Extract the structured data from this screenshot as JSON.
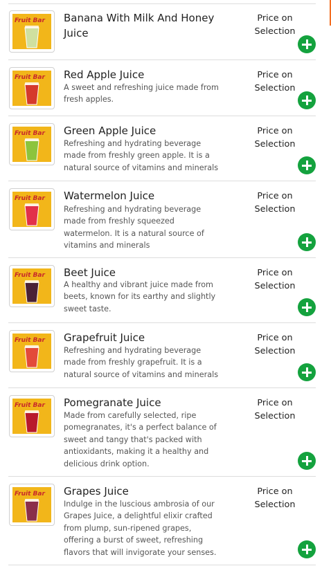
{
  "price_label": "Price on Selection",
  "accent_color": "#14a23e",
  "items": [
    {
      "name": "Banana With Milk And Honey Juice",
      "description": "",
      "icon": "banana-juice-cup",
      "juice_color": "#cfe0a0"
    },
    {
      "name": "Red Apple Juice",
      "description": "A sweet and refreshing juice made from fresh apples.",
      "icon": "red-apple-juice-cup",
      "juice_color": "#d53a2c"
    },
    {
      "name": "Green Apple Juice",
      "description": "Refreshing and hydrating beverage made from freshly green apple. It is a natural source of vitamins and minerals",
      "icon": "green-apple-juice-cup",
      "juice_color": "#8cc43d"
    },
    {
      "name": "Watermelon Juice",
      "description": "Refreshing and hydrating beverage made from freshly squeezed watermelon. It is a natural source of vitamins and minerals",
      "icon": "watermelon-juice-cup",
      "juice_color": "#e2304a"
    },
    {
      "name": "Beet Juice",
      "description": "A healthy and vibrant juice made from beets, known for its earthy and slightly sweet taste.",
      "icon": "beet-juice-cup",
      "juice_color": "#4a2236"
    },
    {
      "name": "Grapefruit Juice",
      "description": "Refreshing and hydrating beverage made from freshly grapefruit. It is a natural source of vitamins and minerals",
      "icon": "grapefruit-juice-cup",
      "juice_color": "#e34a3a"
    },
    {
      "name": "Pomegranate Juice",
      "description": "Made from carefully selected, ripe pomegranates, it's a perfect balance of sweet and tangy that's packed with antioxidants, making it a healthy and delicious drink option.",
      "icon": "pomegranate-juice-cup",
      "juice_color": "#b8192c"
    },
    {
      "name": "Grapes Juice",
      "description": "Indulge in the luscious ambrosia of our Grapes Juice, a delightful elixir crafted from plump, sun-ripened grapes, offering a burst of sweet, refreshing flavors that will invigorate your senses.",
      "icon": "grapes-juice-cup",
      "juice_color": "#8a2f4a"
    }
  ]
}
